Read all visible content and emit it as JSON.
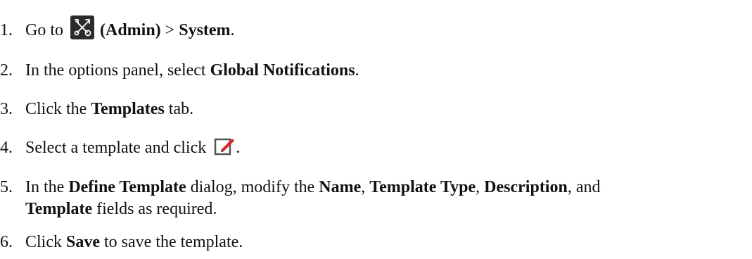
{
  "steps": [
    {
      "number": "1.",
      "parts": {
        "t1": "Go to ",
        "icon": "admin-tools-icon",
        "b1": "(Admin)",
        "t2": " > ",
        "b2": "System",
        "t3": "."
      }
    },
    {
      "number": "2.",
      "parts": {
        "t1": "In the options panel, select ",
        "b1": "Global Notifications",
        "t2": "."
      }
    },
    {
      "number": "3.",
      "parts": {
        "t1": "Click the ",
        "b1": "Templates",
        "t2": " tab."
      }
    },
    {
      "number": "4.",
      "parts": {
        "t1": "Select a template and click ",
        "icon": "edit-icon",
        "t2": "."
      }
    },
    {
      "number": "5.",
      "parts": {
        "t1": "In the ",
        "b1": "Define Template",
        "t2": " dialog, modify the ",
        "b2": "Name",
        "t3": ", ",
        "b3": "Template Type",
        "t4": ", ",
        "b4": "Description",
        "t5": ", and",
        "b5": "Template",
        "t6": " fields as required."
      }
    },
    {
      "number": "6.",
      "parts": {
        "t1": "Click ",
        "b1": "Save",
        "t2": " to save the template."
      }
    }
  ],
  "colors": {
    "text": "#111111",
    "admin_icon_bg": "#2b2b2b",
    "edit_icon_accent": "#d9262c"
  }
}
